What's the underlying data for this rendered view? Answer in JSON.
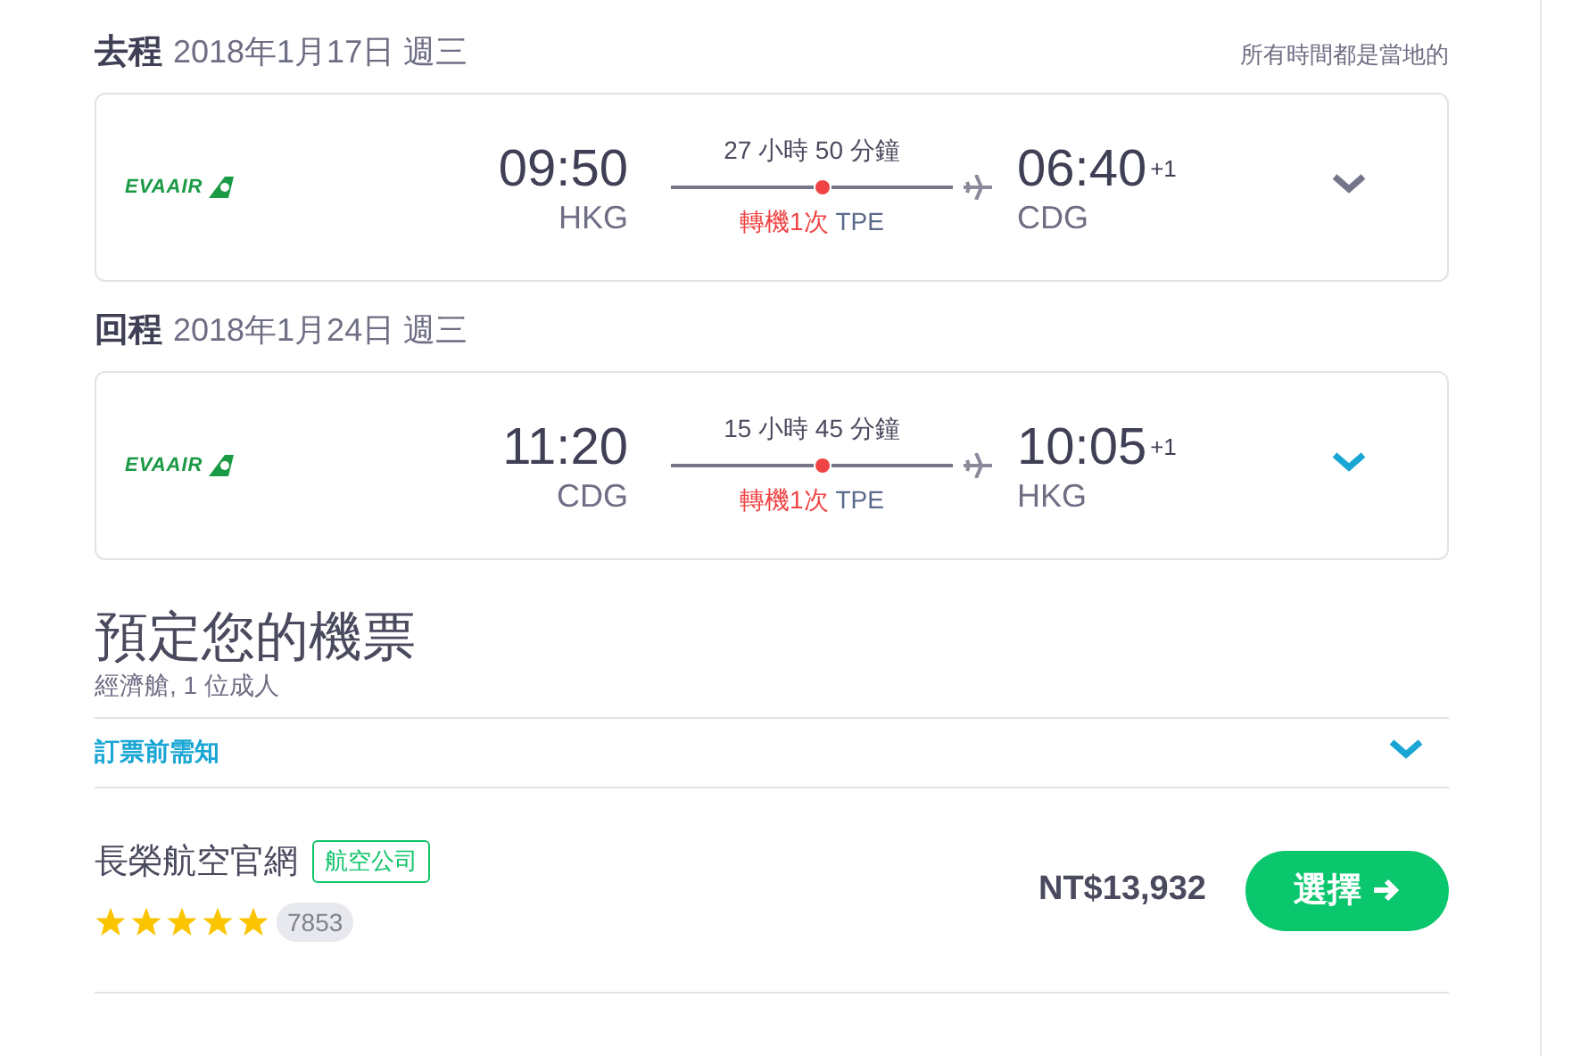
{
  "legs": [
    {
      "label": "去程",
      "date": "2018年1月17日 週三",
      "note": "所有時間都是當地的",
      "airline_logo": "EVAAIR",
      "depart_time": "09:50",
      "depart_airport": "HKG",
      "duration": "27 小時 50 分鐘",
      "stops": "轉機1次",
      "via": "TPE",
      "arrive_time": "06:40",
      "day_offset": "+1",
      "arrive_airport": "CDG",
      "active": false
    },
    {
      "label": "回程",
      "date": "2018年1月24日 週三",
      "airline_logo": "EVAAIR",
      "depart_time": "11:20",
      "depart_airport": "CDG",
      "duration": "15 小時 45 分鐘",
      "stops": "轉機1次",
      "via": "TPE",
      "arrive_time": "10:05",
      "day_offset": "+1",
      "arrive_airport": "HKG",
      "active": true
    }
  ],
  "booking": {
    "title": "預定您的機票",
    "subtitle": "經濟艙, 1 位成人",
    "notice": "訂票前需知",
    "provider": {
      "name": "長榮航空官網",
      "tag": "航空公司",
      "stars": 5,
      "reviews": "7853",
      "price": "NT$13,932",
      "button": "選擇"
    }
  }
}
